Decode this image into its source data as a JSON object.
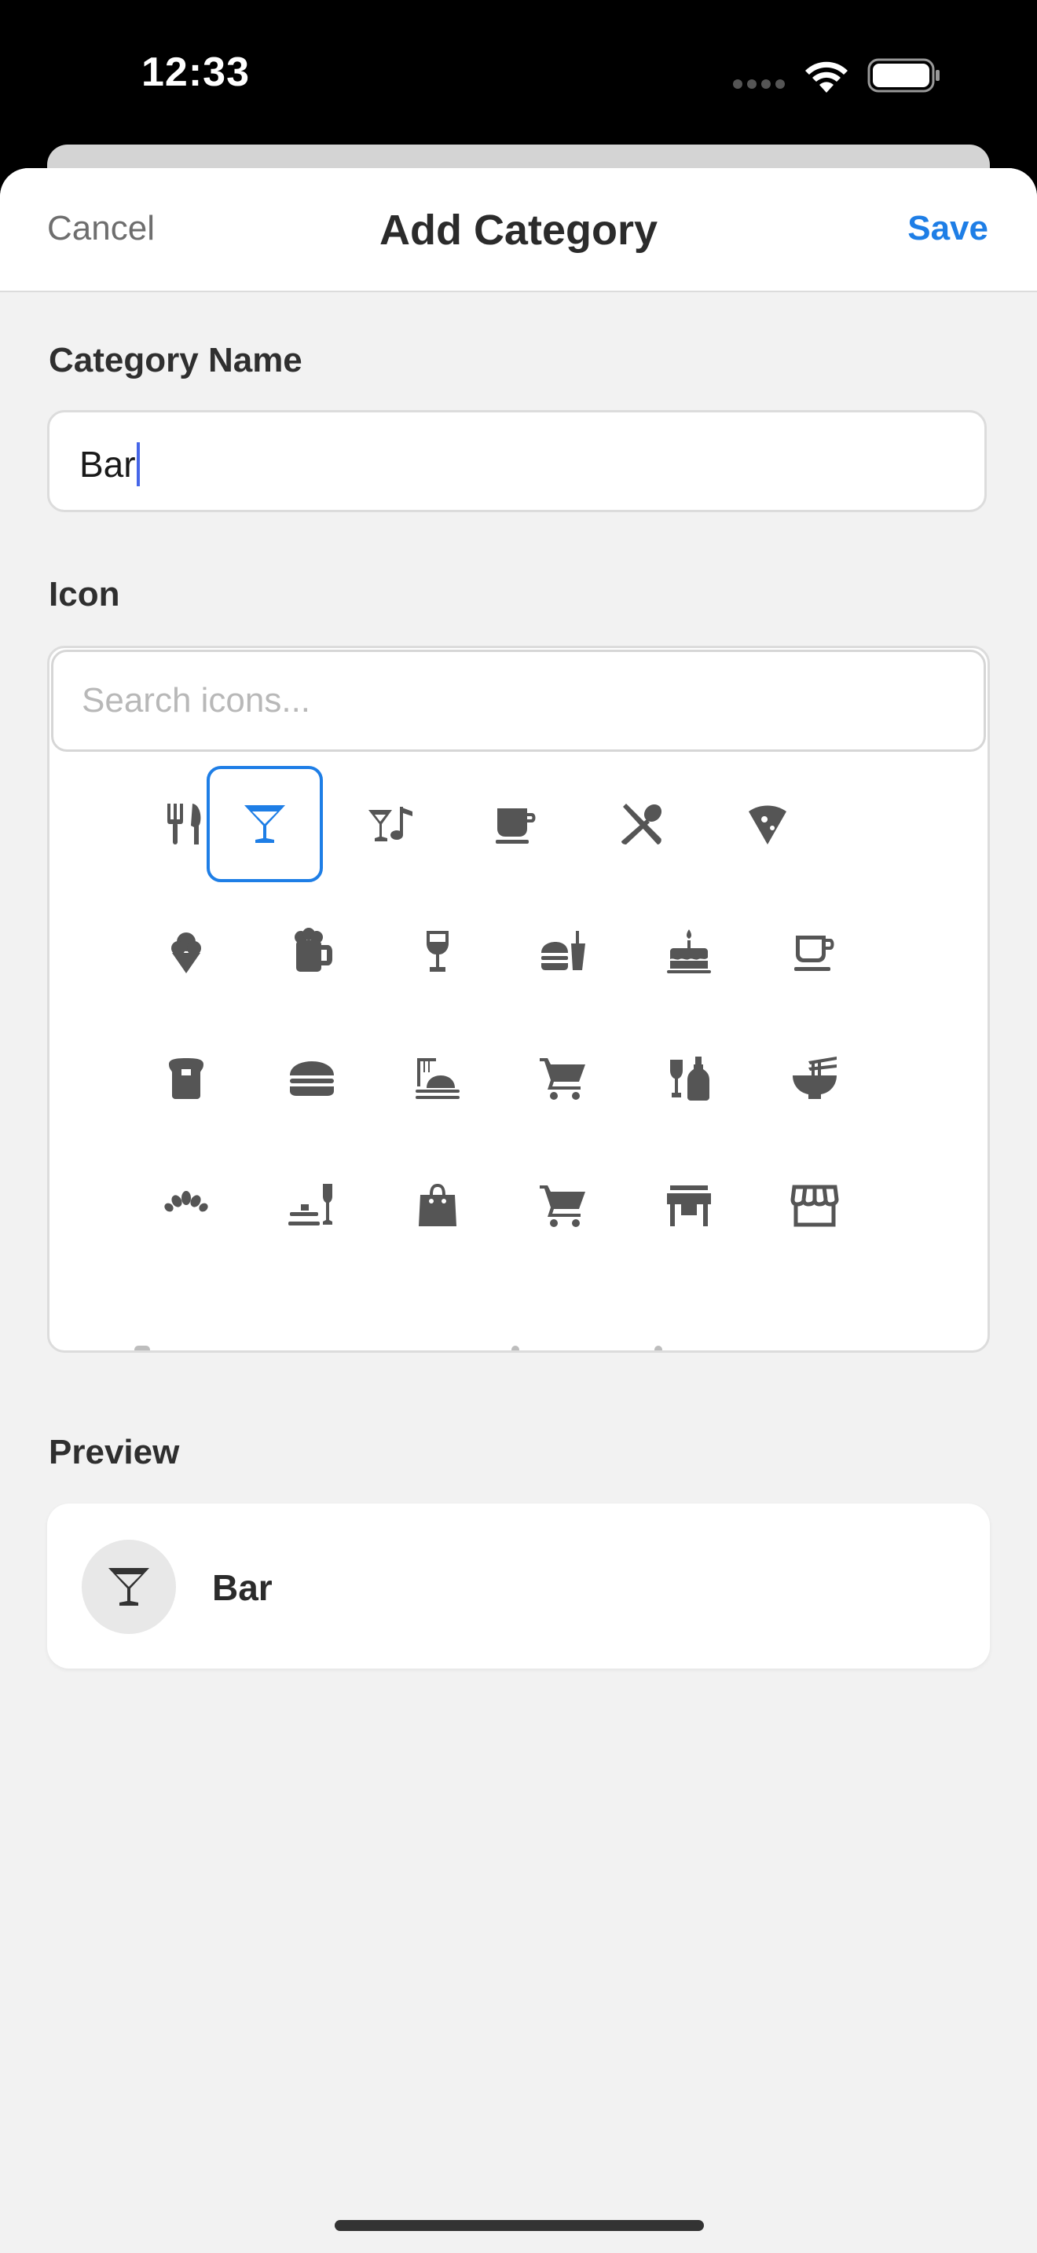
{
  "status_bar": {
    "time": "12:33"
  },
  "nav": {
    "cancel_label": "Cancel",
    "title": "Add Category",
    "save_label": "Save"
  },
  "name_section": {
    "label": "Category Name",
    "value": "Bar"
  },
  "icon_section": {
    "label": "Icon",
    "search_placeholder": "Search icons...",
    "selected_icon": "martini-glass-icon",
    "icons": [
      "fork-knife-icon",
      "martini-glass-icon",
      "cocktail-music-icon",
      "coffee-mug-icon",
      "crossed-utensils-icon",
      "pizza-slice-icon",
      "ice-cream-icon",
      "beer-mug-icon",
      "wine-glass-icon",
      "burger-drink-icon",
      "birthday-cake-icon",
      "teacup-icon",
      "bread-loaf-icon",
      "hamburger-icon",
      "dinner-table-icon",
      "shopping-cart-icon",
      "wine-bottle-icon",
      "noodle-bowl-icon",
      "croissant-icon",
      "champagne-table-icon",
      "shopping-bag-icon",
      "shopping-cart-alt-icon",
      "storefront-icon",
      "store-awning-icon"
    ]
  },
  "preview": {
    "label": "Preview",
    "name": "Bar",
    "icon": "martini-glass-icon"
  },
  "colors": {
    "accent": "#1e7ee6",
    "icon_gray": "#555555",
    "background": "#f2f2f2"
  }
}
